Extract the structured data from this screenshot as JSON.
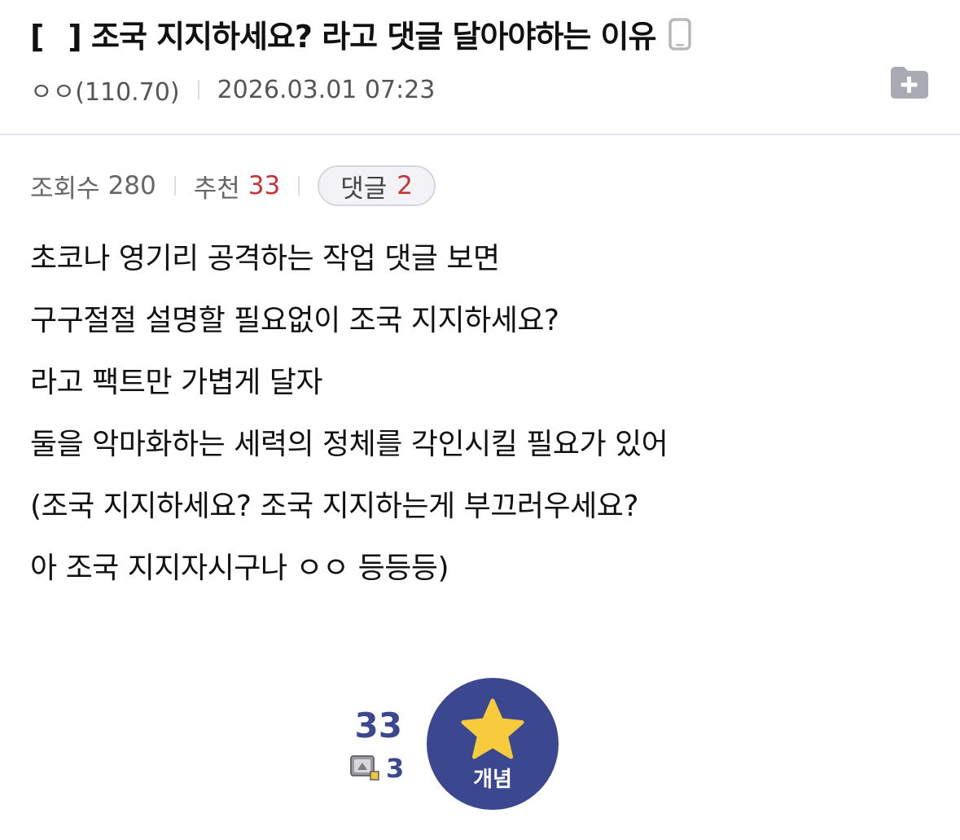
{
  "post": {
    "bracket_open": "[",
    "bracket_close": "]",
    "title": "조국 지지하세요? 라고 댓글 달아야하는 이유",
    "author": "ㅇㅇ(110.70)",
    "datetime": "2026.03.01 07:23"
  },
  "stats": {
    "views_label": "조회수",
    "views_value": "280",
    "recommend_label": "추천",
    "recommend_value": "33",
    "comments_label": "댓글",
    "comments_value": "2"
  },
  "content": {
    "lines": [
      "초코나 영기리 공격하는 작업 댓글 보면",
      "구구절절 설명할 필요없이 조국 지지하세요?",
      "라고 팩트만 가볍게 달자",
      "둘을 악마화하는 세력의 정체를 각인시킬 필요가 있어",
      "(조국 지지하세요? 조국 지지하는게 부끄러우세요?",
      "아 조국 지지자시구나 ㅇㅇ 등등등)"
    ]
  },
  "vote": {
    "count": "33",
    "fixed_count": "3",
    "button_label": "개념"
  },
  "icons": {
    "mobile": "mobile-phone-icon",
    "folder": "folder-add-icon",
    "star": "star-icon",
    "fixed": "fixed-user-icon"
  },
  "colors": {
    "accent_navy": "#3b4890",
    "highlight_red": "#c4343a",
    "star_yellow": "#f7cb3c"
  }
}
